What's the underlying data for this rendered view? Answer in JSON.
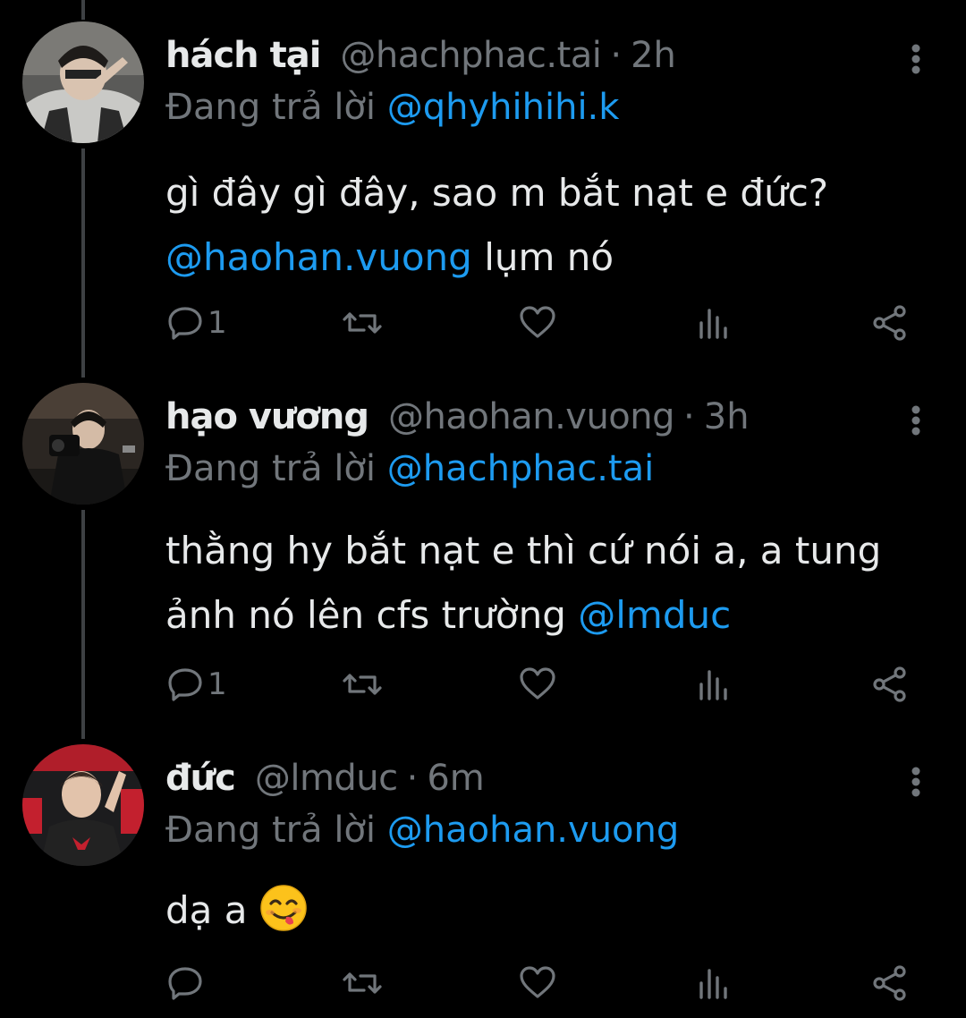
{
  "tweets": [
    {
      "name": "hách tại",
      "handle": "@hachphac.tai",
      "separator": "·",
      "time": "2h",
      "replying_label": "Đang trả lời",
      "replying_to": "@qhyhihihi.k",
      "body": {
        "line1": "gì đây gì đây, sao m bắt nạt e đức?",
        "mention": "@haohan.vuong",
        "after": " lụm nó"
      },
      "reply_count": "1"
    },
    {
      "name": "hạo vương",
      "handle": "@haohan.vuong",
      "separator": "·",
      "time": "3h",
      "replying_label": "Đang trả lời",
      "replying_to": "@hachphac.tai",
      "body": {
        "line1": "thằng hy bắt nạt e thì cứ nói a, a tung",
        "before": "ảnh nó lên cfs trường ",
        "mention": "@lmduc"
      },
      "reply_count": "1"
    },
    {
      "name": "đức",
      "handle": "@lmduc",
      "separator": "·",
      "time": "6m",
      "replying_label": "Đang trả lời",
      "replying_to": "@haohan.vuong",
      "body": {
        "text": "dạ a "
      },
      "reply_count": ""
    }
  ],
  "icons": {
    "reply": "reply-icon",
    "retweet": "retweet-icon",
    "like": "heart-icon",
    "views": "views-icon",
    "share": "share-icon",
    "more": "more-vertical-icon",
    "emoji": "yum-face-emoji"
  },
  "colors": {
    "background": "#000000",
    "text": "#e7e9ea",
    "secondary": "#71767b",
    "accent": "#1d9bf0",
    "thread_line": "#3e4144"
  }
}
